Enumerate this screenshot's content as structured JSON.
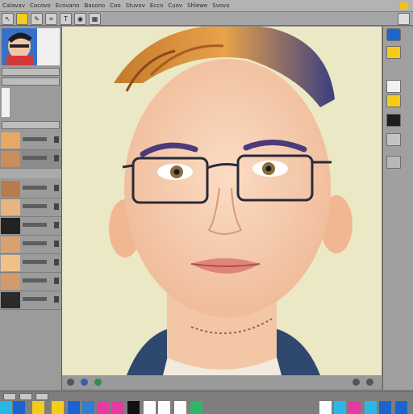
{
  "menubar": {
    "items": [
      "Calavav",
      "Cocovo",
      "Ecovano",
      "Basono",
      "Coo",
      "Stuvov",
      "Ecco",
      "Cuov",
      "Shlewe",
      "Svovo"
    ],
    "accent_swatch": "#f2c114"
  },
  "toolbar": {
    "tools": [
      {
        "icon": "pointer-icon",
        "glyph": "↖"
      },
      {
        "icon": "yellow-swatch-icon",
        "glyph": ""
      },
      {
        "icon": "brush-icon",
        "glyph": "✎"
      },
      {
        "icon": "crop-icon",
        "glyph": "⌗"
      },
      {
        "icon": "text-icon",
        "glyph": "T"
      },
      {
        "icon": "eye-icon",
        "glyph": "◉"
      },
      {
        "icon": "grid-icon",
        "glyph": "▦"
      }
    ]
  },
  "colors": {
    "yellow": "#f5cc18",
    "cyan": "#29b7e8",
    "magenta": "#e43aa3",
    "green": "#2fb56c",
    "blue": "#1b63d1",
    "white": "#ffffff",
    "black": "#111111"
  }
}
